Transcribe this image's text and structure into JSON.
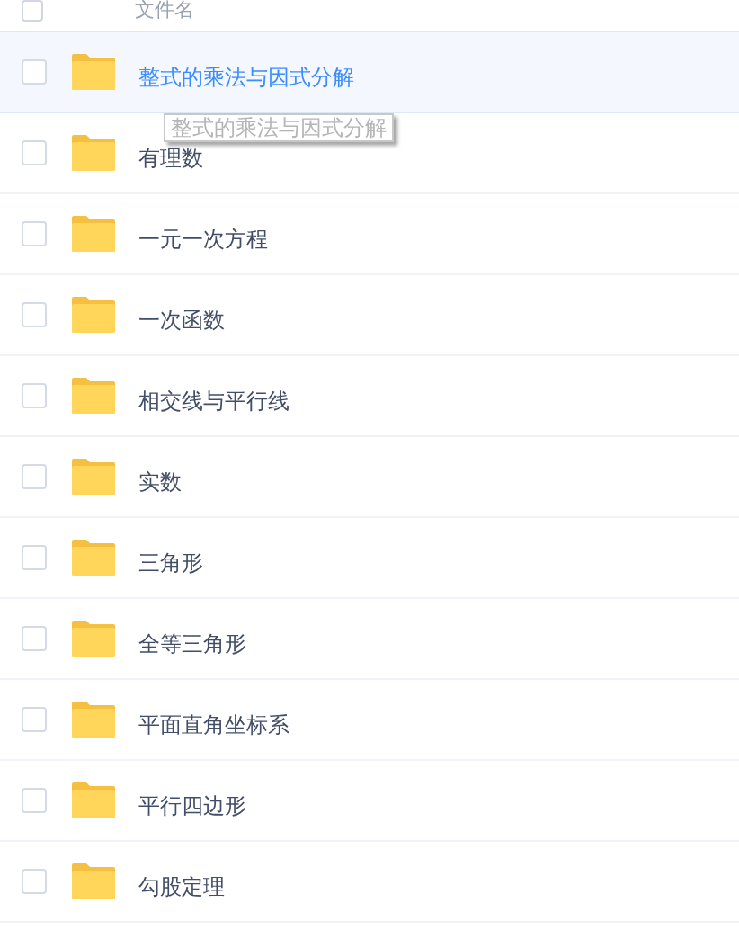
{
  "header": {
    "label": "文件名",
    "checked": false
  },
  "rows": [
    {
      "name": "整式的乘法与因式分解",
      "selected": true,
      "checked": false
    },
    {
      "name": "有理数",
      "selected": false,
      "checked": false
    },
    {
      "name": "一元一次方程",
      "selected": false,
      "checked": false
    },
    {
      "name": "一次函数",
      "selected": false,
      "checked": false
    },
    {
      "name": "相交线与平行线",
      "selected": false,
      "checked": false
    },
    {
      "name": "实数",
      "selected": false,
      "checked": false
    },
    {
      "name": "三角形",
      "selected": false,
      "checked": false
    },
    {
      "name": "全等三角形",
      "selected": false,
      "checked": false
    },
    {
      "name": "平面直角坐标系",
      "selected": false,
      "checked": false
    },
    {
      "name": "平行四边形",
      "selected": false,
      "checked": false
    },
    {
      "name": "勾股定理",
      "selected": false,
      "checked": false
    }
  ],
  "tooltip": {
    "text": "整式的乘法与因式分解"
  }
}
